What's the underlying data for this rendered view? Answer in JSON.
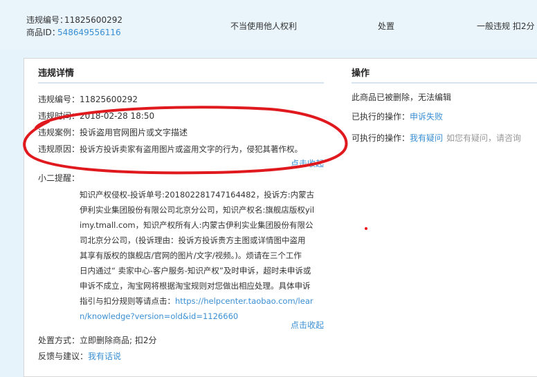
{
  "top": {
    "id_label": "违规编号：",
    "id_value": "11825600292",
    "product_label": "商品ID：",
    "product_value": "548649556116",
    "violation_type": "不当使用他人权利",
    "status": "处置",
    "level": "一般违规 扣2分"
  },
  "details": {
    "heading": "违规详情",
    "rows": [
      {
        "label": "违规编号：",
        "value": "11825600292"
      },
      {
        "label": "违规时间：",
        "value": "2018-02-28 18:50"
      },
      {
        "label": "违规案例：",
        "value": "投诉盗用官网图片或文字描述"
      },
      {
        "label": "违规原因：",
        "value": "投诉方投诉卖家有盗用图片或盗用文字的行为，侵犯其著作权。"
      }
    ],
    "collapse1": "点击收起",
    "reminder_label": "小二提醒：",
    "reminder_text": "知识产权侵权-投诉单号:2018022817471​64482，投诉方:内蒙古\n伊利实业集团股份有限公司北京分公司，知识产权名:旗舰店版权yil\nimy.tmall.com，知识产权所有人:内蒙古伊利实业集团股份有限公\n司北京分公司，(投诉理由：投诉方投诉贵方主图或详情图中盗用\n其享有版权的旗舰店/官网的图片/文字/视频。)。烦请在三个工作\n日内通过“ 卖家中心-客户服务-知识产权”及时申诉，超时未申诉或\n申诉不成立，淘宝网将根据淘宝规则对您做出相应处理。具体申诉\n指引与扣分规则等请点击：",
    "reminder_link": "https://helpcenter.taobao.com/lear\nn/knowledge?version=old&id=1126660",
    "collapse2": "点击收起",
    "disposal_label": "处置方式：",
    "disposal_value": "立即删除商品; 扣2分",
    "feedback_label": "反馈与建议：",
    "feedback_link": "我有话说"
  },
  "actions": {
    "heading": "操作",
    "deleted_note": "此商品已被删除，无法编辑",
    "executed_label": "已执行的操作：",
    "executed_value": "申诉失败",
    "available_label": "可执行的操作：",
    "available_link": "我有疑问",
    "available_hint": "如您有疑问，请咨询"
  },
  "colors": {
    "link": "#3a8fd4",
    "annotation": "#e0191e"
  }
}
